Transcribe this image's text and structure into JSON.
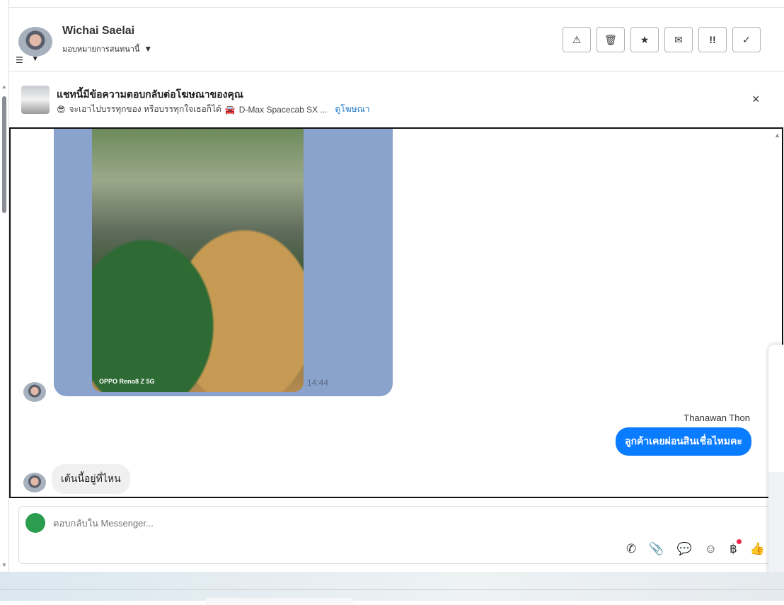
{
  "header": {
    "contact_name": "Wichai Saelai",
    "assign_label": "มอบหมายการสนทนานี้",
    "actions": [
      {
        "name": "report-spam",
        "icon": "▲!"
      },
      {
        "name": "delete",
        "icon": "🗑"
      },
      {
        "name": "star",
        "icon": "★"
      },
      {
        "name": "mark-unread",
        "icon": "✉"
      },
      {
        "name": "important",
        "icon": "!!"
      },
      {
        "name": "done",
        "icon": "✓"
      }
    ]
  },
  "ad_banner": {
    "title": "แชทนี้มีข้อความตอบกลับต่อโฆษณาของคุณ",
    "emoji": "😎",
    "subtitle": "จะเอาไปบรรทุกของ หรือบรรทุกใจเธอก็ได้",
    "car_emoji": "🚘",
    "product": "D-Max Spacecab SX ...",
    "link": "ดูโฆษณา",
    "close": "×"
  },
  "messages": {
    "photo_watermark": "OPPO Reno8 Z 5G",
    "photo_time": "14:44",
    "outgoing_sender": "Thanawan Thon",
    "outgoing_text": "ลูกค้าเคยผ่อนสินเชื่อไหมคะ",
    "incoming_text": "เต้นนี้อยู่ที่ไหน"
  },
  "composer": {
    "placeholder": "ตอบกลับใน Messenger...",
    "tools": [
      "📞",
      "📎",
      "💬",
      "☺",
      "฿",
      "👍"
    ]
  },
  "colors": {
    "outgoing": "#0a7cff",
    "link": "#1877c9"
  }
}
